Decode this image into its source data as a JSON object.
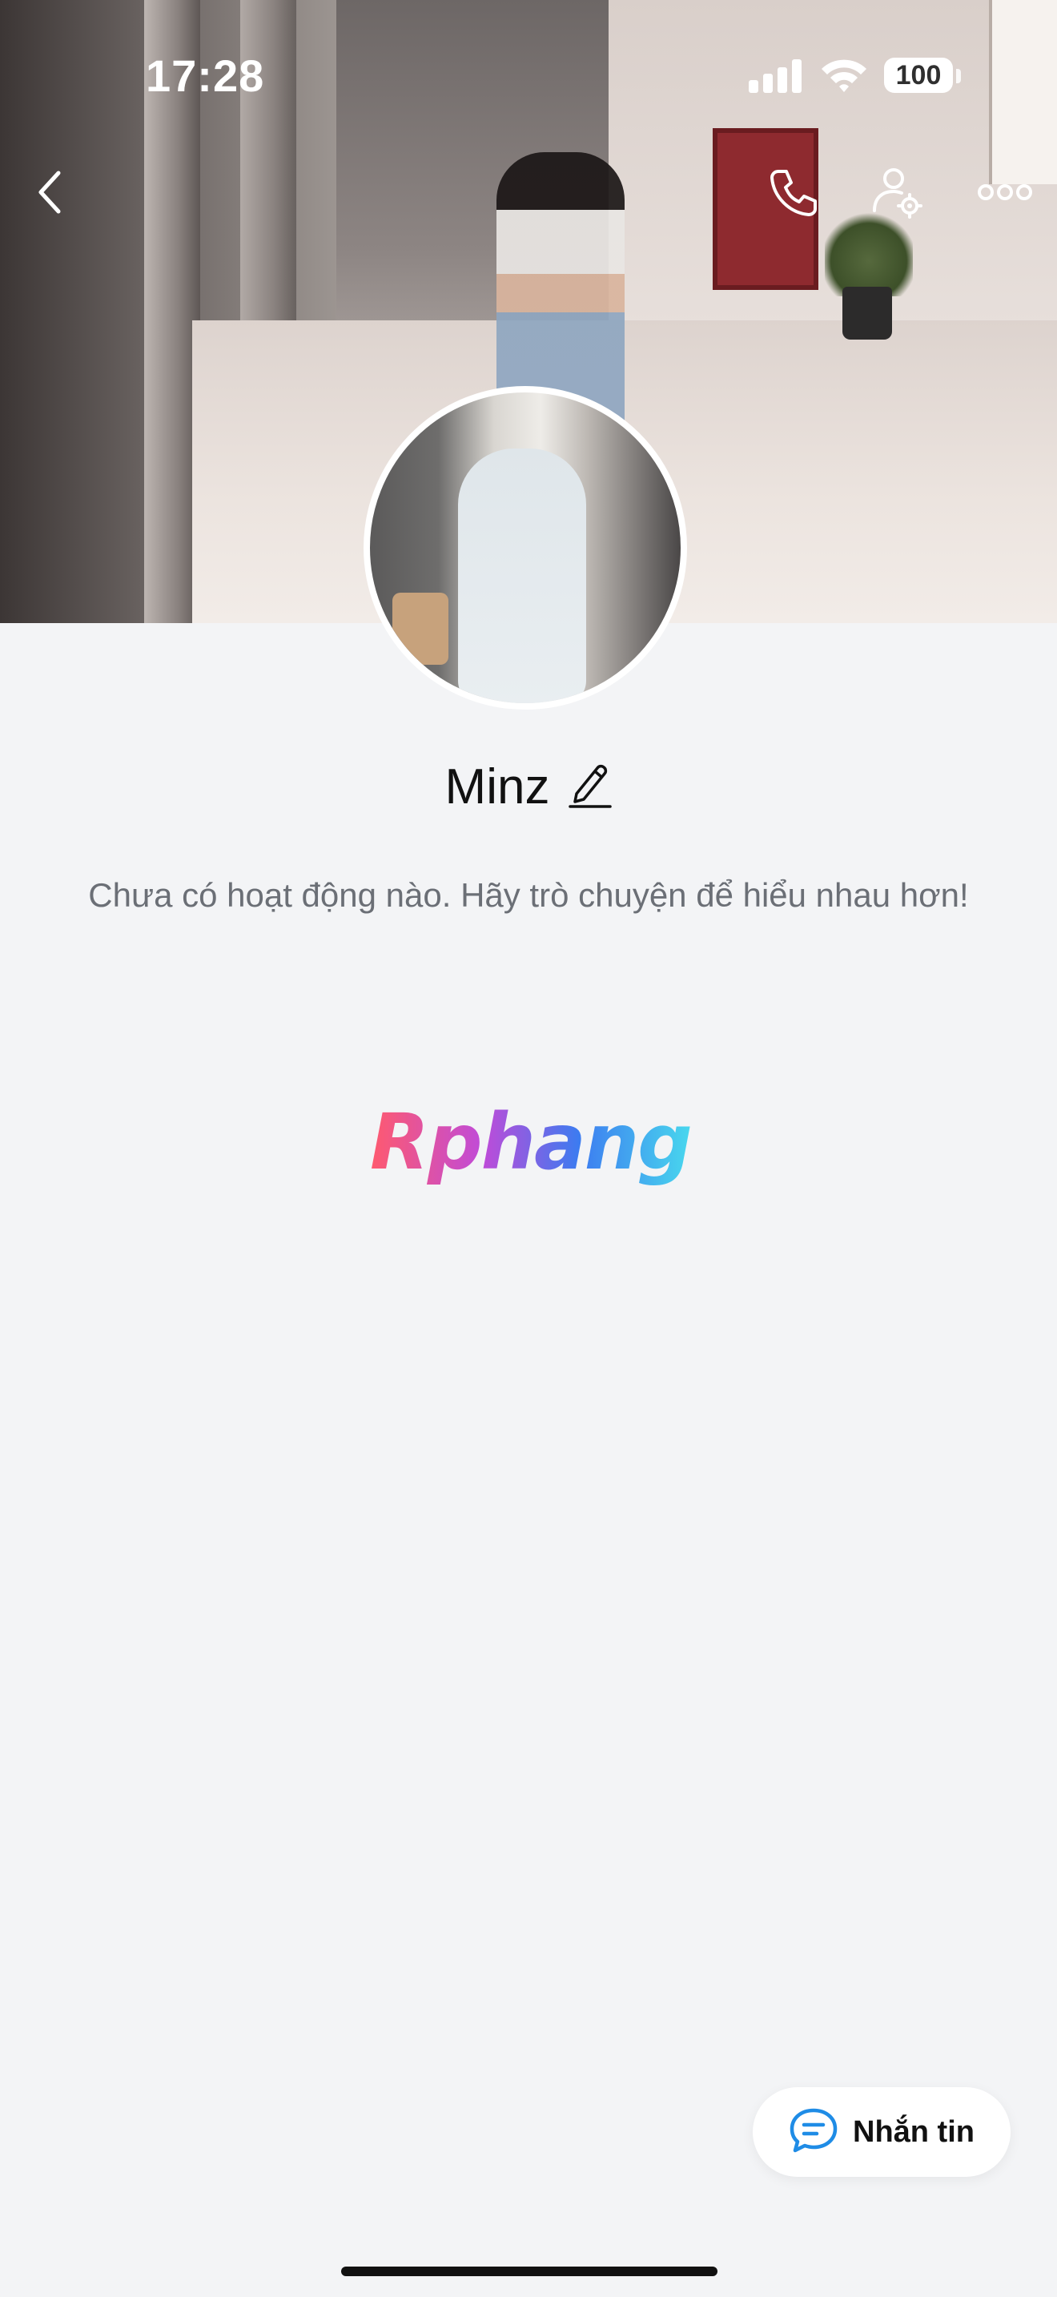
{
  "status_bar": {
    "time": "17:28",
    "battery": "100"
  },
  "header": {
    "back_icon": "chevron-left-icon",
    "call_icon": "phone-icon",
    "settings_icon": "user-gear-icon",
    "more_icon": "more-dots-icon"
  },
  "profile": {
    "name": "Minz",
    "empty_activity_text": "Chưa có hoạt động nào. Hãy trò chuyện để hiểu nhau hơn!"
  },
  "watermark": {
    "text": "Rphang"
  },
  "actions": {
    "message_label": "Nhắn tin",
    "message_icon": "chat-bubble-icon"
  },
  "colors": {
    "background": "#f3f4f6",
    "accent": "#1f8ce6"
  }
}
